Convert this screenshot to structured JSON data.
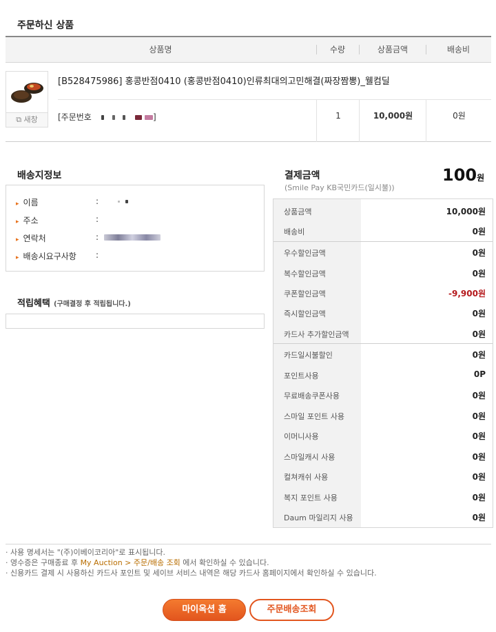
{
  "ordered": {
    "title": "주문하신 상품",
    "columns": {
      "name": "상품명",
      "qty": "수량",
      "amount": "상품금액",
      "shipping": "배송비"
    },
    "product": {
      "name": "[B528475986] 홍콩반점0410 (홍콩반점0410)인류최대의고민해결(짜장짬뽕)_웰컴딜",
      "new_window": "새창",
      "order_no_label": "[주문번호",
      "order_no_close": "]",
      "qty": "1",
      "amount": "10,000원",
      "shipping": "0원"
    }
  },
  "shipping_info": {
    "title": "배송지정보",
    "fields": [
      {
        "label": "이름",
        "colon": ":"
      },
      {
        "label": "주소",
        "colon": ":"
      },
      {
        "label": "연락처",
        "colon": ":"
      },
      {
        "label": "배송시요구사항",
        "colon": ":"
      }
    ]
  },
  "points": {
    "title": "적립혜택",
    "note": "(구매결정 후 적립됩니다.)"
  },
  "payment": {
    "title": "결제금액",
    "method": "(Smile Pay KB국민카드(일시불))",
    "total": "100",
    "total_unit": "원",
    "rows": [
      {
        "label": "상품금액",
        "value": "10,000원"
      },
      {
        "label": "배송비",
        "value": "0원"
      },
      {
        "label": "우수할인금액",
        "value": "0원"
      },
      {
        "label": "복수할인금액",
        "value": "0원"
      },
      {
        "label": "쿠폰할인금액",
        "value": "-9,900원"
      },
      {
        "label": "즉시할인금액",
        "value": "0원"
      },
      {
        "label": "카드사 추가할인금액",
        "value": "0원"
      },
      {
        "label": "카드일시불할인",
        "value": "0원"
      },
      {
        "label": "포인트사용",
        "value": "0P"
      },
      {
        "label": "무료배송쿠폰사용",
        "value": "0원"
      },
      {
        "label": "스마일 포인트 사용",
        "value": "0원"
      },
      {
        "label": "이머니사용",
        "value": "0원"
      },
      {
        "label": "스마일캐시 사용",
        "value": "0원"
      },
      {
        "label": "컬쳐캐쉬 사용",
        "value": "0원"
      },
      {
        "label": "복지 포인트 사용",
        "value": "0원"
      },
      {
        "label": "Daum 마일리지 사용",
        "value": "0원"
      }
    ],
    "discount_color": "#b4181b"
  },
  "notes": {
    "line1": "· 사용 명세서는 \"(주)이베이코리아\"로 표시됩니다.",
    "line2_pre": "· 영수증은 구매종료 후 ",
    "line2_link": "My Auction > 주문/배송 조회",
    "line2_post": " 에서 확인하실 수 있습니다.",
    "line3": "· 신용카드 결제 시 사용하신 카드사 포인트 및 세이브 서비스 내역은 해당 카드사 홈페이지에서 확인하실 수 있습니다."
  },
  "buttons": {
    "my_auction": "마이옥션 홈",
    "order_tracking": "주문배송조회"
  },
  "colors": {
    "accent": "#e2551e",
    "bullet": "#e8731e"
  }
}
